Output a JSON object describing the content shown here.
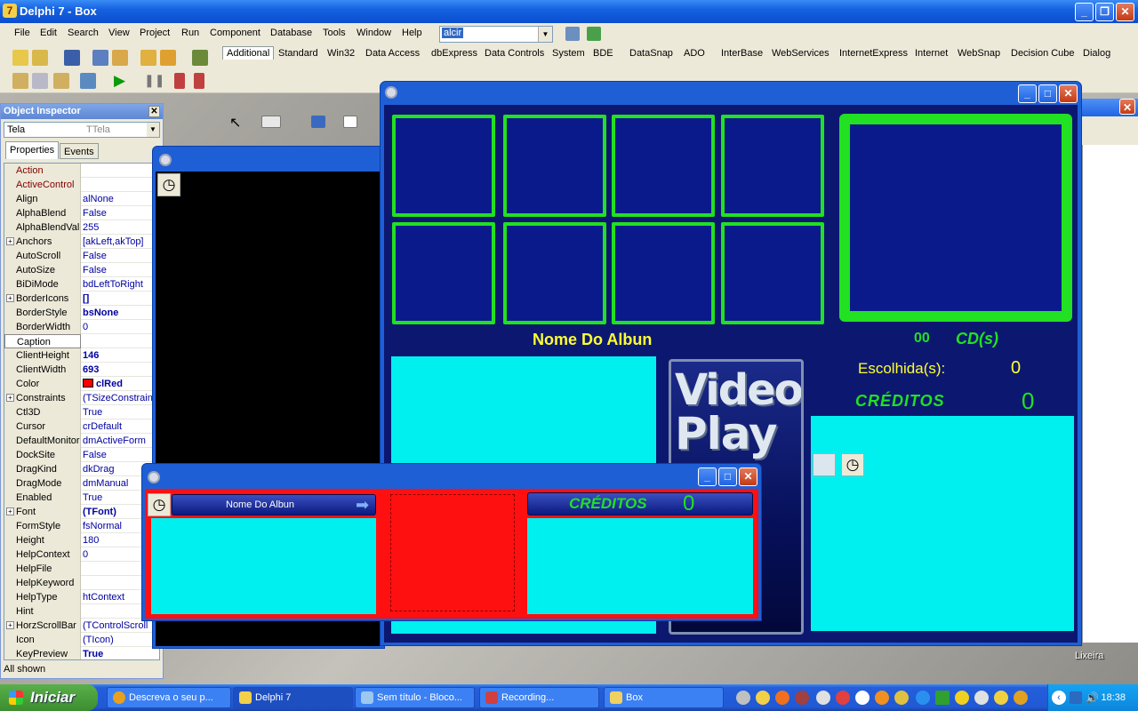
{
  "ide": {
    "title": "Delphi 7 - Box",
    "menu": [
      "File",
      "Edit",
      "Search",
      "View",
      "Project",
      "Run",
      "Component",
      "Database",
      "Tools",
      "Window",
      "Help"
    ],
    "desktop_combo": "alcir",
    "palette_tabs": [
      "Additional",
      "Standard",
      "Win32",
      "Data Access",
      "dbExpress",
      "Data Controls",
      "System",
      "BDE",
      "DataSnap",
      "ADO",
      "InterBase",
      "WebServices",
      "InternetExpress",
      "Internet",
      "WebSnap",
      "Decision Cube",
      "Dialog"
    ]
  },
  "object_inspector": {
    "title": "Object Inspector",
    "component_name": "Tela",
    "component_type": "TTela",
    "tabs": [
      "Properties",
      "Events"
    ],
    "status": "All shown",
    "properties": [
      {
        "name": "Action",
        "value": "",
        "event": true
      },
      {
        "name": "ActiveControl",
        "value": "",
        "event": true
      },
      {
        "name": "Align",
        "value": "alNone"
      },
      {
        "name": "AlphaBlend",
        "value": "False"
      },
      {
        "name": "AlphaBlendValu",
        "value": "255"
      },
      {
        "name": "Anchors",
        "value": "[akLeft,akTop]",
        "plus": true
      },
      {
        "name": "AutoScroll",
        "value": "False"
      },
      {
        "name": "AutoSize",
        "value": "False"
      },
      {
        "name": "BiDiMode",
        "value": "bdLeftToRight"
      },
      {
        "name": "BorderIcons",
        "value": "[]",
        "plus": true,
        "bold": true
      },
      {
        "name": "BorderStyle",
        "value": "bsNone",
        "bold": true
      },
      {
        "name": "BorderWidth",
        "value": "0"
      },
      {
        "name": "Caption",
        "value": "",
        "selected": true
      },
      {
        "name": "ClientHeight",
        "value": "146",
        "bold": true
      },
      {
        "name": "ClientWidth",
        "value": "693",
        "bold": true
      },
      {
        "name": "Color",
        "value": "clRed",
        "bold": true,
        "swatch": "#ff0000"
      },
      {
        "name": "Constraints",
        "value": "(TSizeConstrain",
        "plus": true
      },
      {
        "name": "Ctl3D",
        "value": "True"
      },
      {
        "name": "Cursor",
        "value": "crDefault"
      },
      {
        "name": "DefaultMonitor",
        "value": "dmActiveForm"
      },
      {
        "name": "DockSite",
        "value": "False"
      },
      {
        "name": "DragKind",
        "value": "dkDrag"
      },
      {
        "name": "DragMode",
        "value": "dmManual"
      },
      {
        "name": "Enabled",
        "value": "True"
      },
      {
        "name": "Font",
        "value": "(TFont)",
        "plus": true,
        "bold": true
      },
      {
        "name": "FormStyle",
        "value": "fsNormal"
      },
      {
        "name": "Height",
        "value": "180"
      },
      {
        "name": "HelpContext",
        "value": "0"
      },
      {
        "name": "HelpFile",
        "value": ""
      },
      {
        "name": "HelpKeyword",
        "value": ""
      },
      {
        "name": "HelpType",
        "value": "htContext"
      },
      {
        "name": "Hint",
        "value": ""
      },
      {
        "name": "HorzScrollBar",
        "value": "(TControlScroll",
        "plus": true
      },
      {
        "name": "Icon",
        "value": "(TIcon)"
      },
      {
        "name": "KeyPreview",
        "value": "True",
        "bold": true
      }
    ]
  },
  "box_form": {
    "album_name_label": "Nome Do Albun",
    "cd_count": "00",
    "cd_label": "CD(s)",
    "chosen_label": "Escolhida(s):",
    "chosen_value": "0",
    "credits_label": "CRÉDITOS",
    "credits_value": "0",
    "logo_line1": "Video",
    "logo_line2": "Play"
  },
  "red_form": {
    "album_bar_label": "Nome Do Albun",
    "credits_label": "CRÉDITOS",
    "credits_value": "0"
  },
  "desktop": {
    "recycle_bin": "Lixeira"
  },
  "taskbar": {
    "start": "Iniciar",
    "tasks": [
      "Descreva o seu p...",
      "Delphi 7",
      "Sem título - Bloco...",
      "Recording...",
      "Box"
    ],
    "clock": "18:38"
  },
  "colors": {
    "form_navy": "#0c1870",
    "tile_border": "#22e022",
    "cyan_panel": "#00f0f0",
    "label_yellow": "#ffff30",
    "credit_green": "#22e022",
    "red_form": "#ff1010"
  }
}
